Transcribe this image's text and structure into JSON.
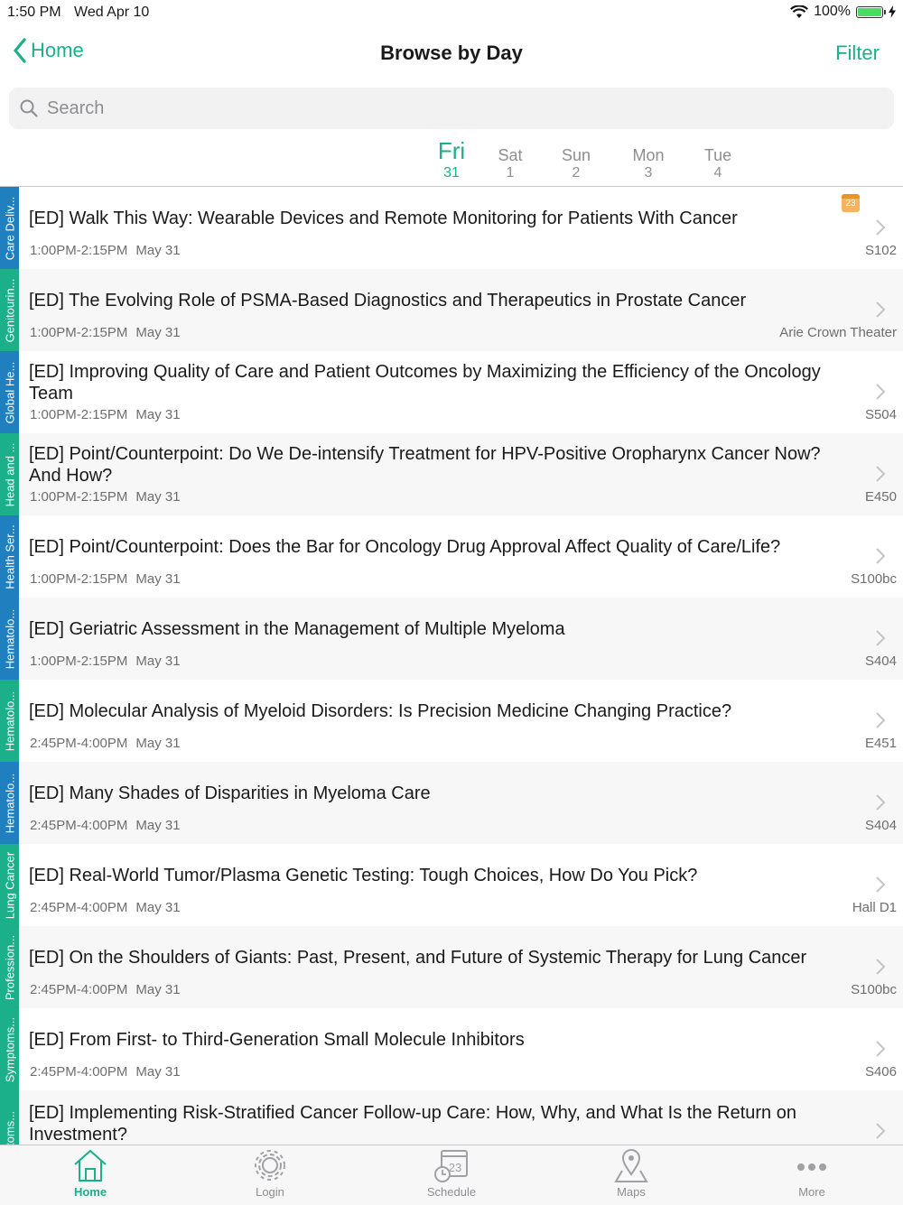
{
  "status_bar": {
    "time": "1:50 PM",
    "date": "Wed Apr 10",
    "battery": "100%"
  },
  "nav": {
    "back_label": "Home",
    "title": "Browse by Day",
    "filter_label": "Filter"
  },
  "search": {
    "placeholder": "Search"
  },
  "days": [
    {
      "name": "Fri",
      "num": "31",
      "active": true
    },
    {
      "name": "Sat",
      "num": "1",
      "active": false
    },
    {
      "name": "Sun",
      "num": "2",
      "active": false
    },
    {
      "name": "Mon",
      "num": "3",
      "active": false
    },
    {
      "name": "Tue",
      "num": "4",
      "active": false
    }
  ],
  "sessions": [
    {
      "track": "Care Deliv...",
      "track_color": "#1f7fbf",
      "title": "[ED] Walk This Way: Wearable Devices and Remote Monitoring for Patients With Cancer",
      "time": "1:00PM-2:15PM",
      "date": "May 31",
      "room": "S102",
      "calendar_icon": "calendar-badge-icon",
      "calendar_text": "23"
    },
    {
      "track": "Genitourin...",
      "track_color": "#1bb08a",
      "title": "[ED] The Evolving Role of PSMA-Based Diagnostics and Therapeutics in Prostate Cancer",
      "time": "1:00PM-2:15PM",
      "date": "May 31",
      "room": "Arie Crown Theater"
    },
    {
      "track": "Global He...",
      "track_color": "#1f7fbf",
      "title": "[ED] Improving Quality of Care and Patient Outcomes by Maximizing the Efficiency of the Oncology Team",
      "time": "1:00PM-2:15PM",
      "date": "May 31",
      "room": "S504"
    },
    {
      "track": "Head and ...",
      "track_color": "#1bb08a",
      "title": "[ED] Point/Counterpoint: Do We De-intensify Treatment for HPV-Positive Oropharynx Cancer Now? And How?",
      "time": "1:00PM-2:15PM",
      "date": "May 31",
      "room": "E450"
    },
    {
      "track": "Health Ser...",
      "track_color": "#1f7fbf",
      "title": "[ED] Point/Counterpoint: Does the Bar for Oncology Drug Approval Affect Quality of Care/Life?",
      "time": "1:00PM-2:15PM",
      "date": "May 31",
      "room": "S100bc"
    },
    {
      "track": "Hematolo...",
      "track_color": "#1f7fbf",
      "title": "[ED] Geriatric Assessment in the Management of Multiple Myeloma",
      "time": "1:00PM-2:15PM",
      "date": "May 31",
      "room": "S404"
    },
    {
      "track": "Hematolo...",
      "track_color": "#1bb08a",
      "title": "[ED] Molecular Analysis of Myeloid Disorders: Is Precision Medicine Changing Practice?",
      "time": "2:45PM-4:00PM",
      "date": "May 31",
      "room": "E451"
    },
    {
      "track": "Hematolo...",
      "track_color": "#1f7fbf",
      "title": "[ED] Many Shades of Disparities in Myeloma Care",
      "time": "2:45PM-4:00PM",
      "date": "May 31",
      "room": "S404"
    },
    {
      "track": "Lung Cancer",
      "track_color": "#1bb08a",
      "title": "[ED] Real-World Tumor/Plasma Genetic Testing: Tough Choices, How Do You Pick?",
      "time": "2:45PM-4:00PM",
      "date": "May 31",
      "room": "Hall D1"
    },
    {
      "track": "Profession...",
      "track_color": "#1bb08a",
      "title": "[ED] On the Shoulders of Giants: Past, Present, and Future of Systemic Therapy for Lung Cancer",
      "time": "2:45PM-4:00PM",
      "date": "May 31",
      "room": "S100bc"
    },
    {
      "track": "Symptoms...",
      "track_color": "#1bb08a",
      "title": "[ED] From First- to Third-Generation Small Molecule Inhibitors",
      "time": "2:45PM-4:00PM",
      "date": "May 31",
      "room": "S406"
    },
    {
      "track": "ptoms...",
      "track_color": "#1bb08a",
      "title": "[ED] Implementing Risk-Stratified Cancer Follow-up Care: How, Why, and What Is the Return on Investment?",
      "time": "",
      "date": "",
      "room": ""
    }
  ],
  "tabs": [
    {
      "label": "Home",
      "icon": "home-icon",
      "active": true
    },
    {
      "label": "Login",
      "icon": "gear-icon",
      "active": false
    },
    {
      "label": "Schedule",
      "icon": "schedule-icon",
      "active": false
    },
    {
      "label": "Maps",
      "icon": "map-pin-icon",
      "active": false
    },
    {
      "label": "More",
      "icon": "more-icon",
      "active": false
    }
  ],
  "colors": {
    "accent": "#1bb08a",
    "track_blue": "#1f7fbf",
    "track_green": "#1bb08a"
  }
}
